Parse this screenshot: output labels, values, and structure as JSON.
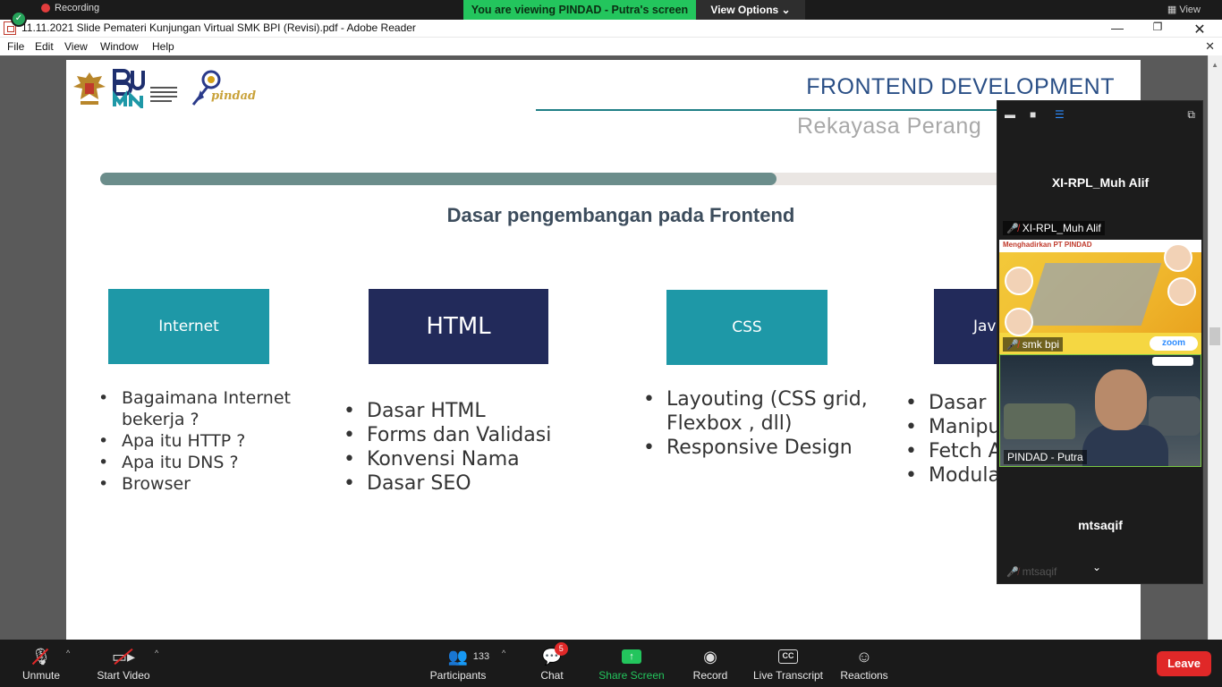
{
  "zoom": {
    "recording_label": "Recording",
    "viewing_banner": "You are viewing PINDAD - Putra's screen",
    "view_options": "View Options",
    "view_right": "View"
  },
  "adobe": {
    "window_title": "11.11.2021 Slide Pemateri Kunjungan Virtual SMK BPI (Revisi).pdf - Adobe Reader",
    "menu": [
      "File",
      "Edit",
      "View",
      "Window",
      "Help"
    ]
  },
  "slide": {
    "logo_text": "pindad",
    "title": "FRONTEND DEVELOPMENT",
    "subtitle": "Rekayasa Perang",
    "heading": "Dasar pengembangan pada Frontend",
    "progress": 0.675,
    "topics": [
      {
        "label": "Internet",
        "items": [
          "Bagaimana Internet bekerja ?",
          "Apa itu HTTP ?",
          "Apa itu DNS ?",
          "Browser"
        ]
      },
      {
        "label": "HTML",
        "items": [
          "Dasar HTML",
          "Forms dan Validasi",
          "Konvensi Nama",
          "Dasar SEO"
        ]
      },
      {
        "label": "CSS",
        "items": [
          "Layouting (CSS grid, Flexbox , dll)",
          "Responsive Design"
        ]
      },
      {
        "label": "Jav",
        "items": [
          "Dasar",
          "Manipu",
          "Fetch A",
          "Modula"
        ]
      }
    ]
  },
  "panel": {
    "tile1_name": "XI-RPL_Muh Alif",
    "tile1_label": "XI-RPL_Muh Alif",
    "share_header": "Menghadirkan PT PINDAD",
    "zoom_chip": "zoom",
    "share_label": "smk bpi",
    "video_label": "PINDAD - Putra",
    "tile4_name": "mtsaqif",
    "tile4_label": "mtsaqif"
  },
  "toolbar": {
    "unmute": "Unmute",
    "start_video": "Start Video",
    "participants": "Participants",
    "participants_count": "133",
    "chat": "Chat",
    "chat_badge": "5",
    "share_screen": "Share Screen",
    "record": "Record",
    "live_transcript": "Live Transcript",
    "reactions": "Reactions",
    "leave": "Leave"
  },
  "colors": {
    "teal_box": "#1e98a7",
    "navy_box": "#222a5a",
    "banner_green": "#23c55d",
    "leave_red": "#e02828"
  }
}
